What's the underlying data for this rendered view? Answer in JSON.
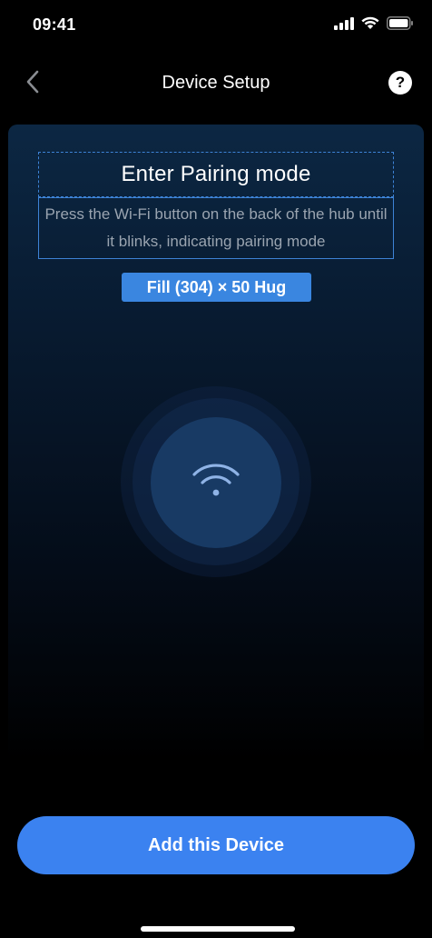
{
  "status_bar": {
    "time": "09:41",
    "icons": [
      "cellular-signal-icon",
      "wifi-signal-icon",
      "battery-icon"
    ]
  },
  "header": {
    "title": "Device Setup",
    "back_icon": "chevron-left-icon",
    "help_label": "?"
  },
  "setup": {
    "title": "Enter Pairing mode",
    "description": "Press the Wi-Fi button on the back of the hub until it blinks, indicating pairing mode",
    "dimension_badge": "Fill (304) × 50 Hug",
    "center_icon": "wifi-icon"
  },
  "cta": {
    "label": "Add this Device"
  },
  "colors": {
    "background": "#000000",
    "accent": "#3b82f0",
    "selection_outline": "#3d83d6",
    "circle_fill": "#183a64",
    "wifi_icon": "#8fb3e6"
  }
}
